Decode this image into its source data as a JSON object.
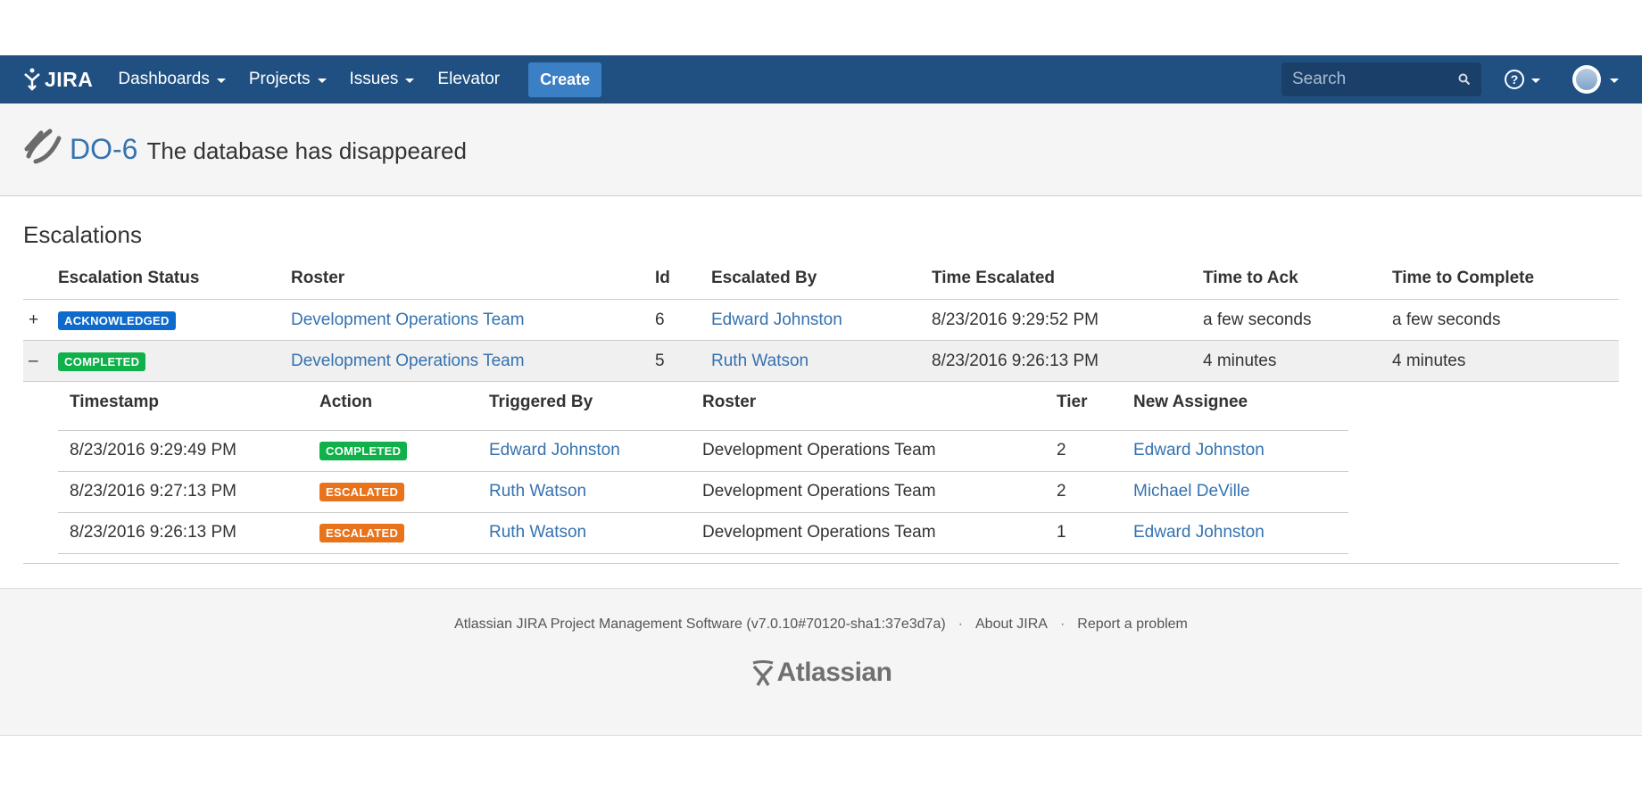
{
  "nav": {
    "logo_text": "JIRA",
    "items": [
      {
        "label": "Dashboards",
        "dropdown": true
      },
      {
        "label": "Projects",
        "dropdown": true
      },
      {
        "label": "Issues",
        "dropdown": true
      },
      {
        "label": "Elevator",
        "dropdown": false
      }
    ],
    "create_label": "Create",
    "search_placeholder": "Search",
    "help_glyph": "?"
  },
  "issue": {
    "key": "DO-6",
    "summary": "The database has disappeared"
  },
  "escalations": {
    "title": "Escalations",
    "columns": [
      "Escalation Status",
      "Roster",
      "Id",
      "Escalated By",
      "Time Escalated",
      "Time to Ack",
      "Time to Complete"
    ],
    "rows": [
      {
        "toggle": "+",
        "status": "ACKNOWLEDGED",
        "status_color": "#0e6bcb",
        "roster": "Development Operations Team",
        "id": "6",
        "escalated_by": "Edward Johnston",
        "time_escalated": "8/23/2016 9:29:52 PM",
        "time_to_ack": "a few seconds",
        "time_to_complete": "a few seconds"
      },
      {
        "toggle": "–",
        "status": "COMPLETED",
        "status_color": "#10b04a",
        "roster": "Development Operations Team",
        "id": "5",
        "escalated_by": "Ruth Watson",
        "time_escalated": "8/23/2016 9:26:13 PM",
        "time_to_ack": "4 minutes",
        "time_to_complete": "4 minutes"
      }
    ],
    "detail": {
      "columns": [
        "Timestamp",
        "Action",
        "Triggered By",
        "Roster",
        "Tier",
        "New Assignee"
      ],
      "rows": [
        {
          "timestamp": "8/23/2016 9:29:49 PM",
          "action": "COMPLETED",
          "action_color": "#10b04a",
          "triggered_by": "Edward Johnston",
          "roster": "Development Operations Team",
          "tier": "2",
          "new_assignee": "Edward Johnston"
        },
        {
          "timestamp": "8/23/2016 9:27:13 PM",
          "action": "ESCALATED",
          "action_color": "#e8731b",
          "triggered_by": "Ruth Watson",
          "roster": "Development Operations Team",
          "tier": "2",
          "new_assignee": "Michael DeVille"
        },
        {
          "timestamp": "8/23/2016 9:26:13 PM",
          "action": "ESCALATED",
          "action_color": "#e8731b",
          "triggered_by": "Ruth Watson",
          "roster": "Development Operations Team",
          "tier": "1",
          "new_assignee": "Edward Johnston"
        }
      ]
    }
  },
  "footer": {
    "software": "Atlassian JIRA Project Management Software (v7.0.10#70120-sha1:37e3d7a)",
    "about": "About JIRA",
    "report": "Report a problem",
    "separator": "·",
    "brand": "Atlassian"
  },
  "colors": {
    "navbar": "#205081",
    "link": "#3572b0",
    "create_button": "#3b7fc4"
  }
}
